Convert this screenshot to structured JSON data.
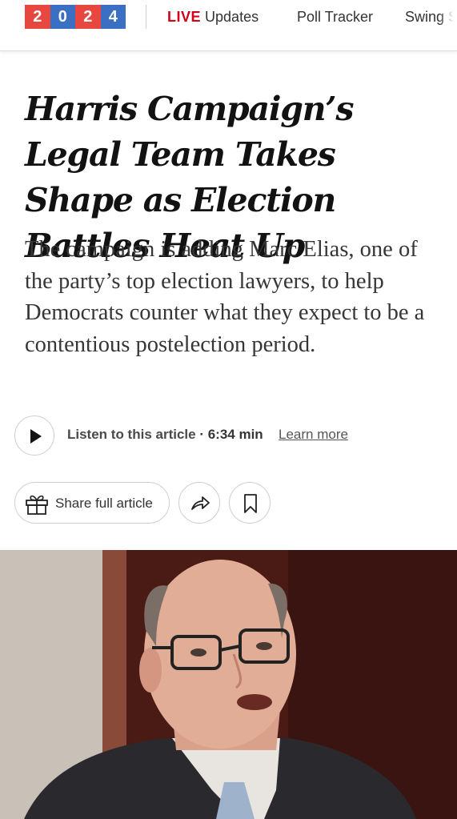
{
  "nav": {
    "logo_digits": [
      "2",
      "0",
      "2",
      "4"
    ],
    "logo_colors": [
      "#e8473f",
      "#3a6fc4",
      "#e8473f",
      "#3a6fc4"
    ],
    "live_label": "LIVE",
    "live_suffix": "Updates",
    "poll_tracker": "Poll Tracker",
    "swing": "Swing S"
  },
  "article": {
    "headline": "Harris Campaign’s Legal Team Takes Shape as Election Battles Heat Up",
    "summary": "The campaign is adding Marc Elias, one of the party’s top election lawyers, to help Democrats counter what they expect to be a contentious postelection period."
  },
  "audio": {
    "listen_label": "Listen to this article",
    "separator": " · ",
    "duration": "6:34 min",
    "learn_more": "Learn more"
  },
  "actions": {
    "share_label": "Share full article"
  },
  "icons": {
    "play": "play-icon",
    "gift": "gift-icon",
    "forward": "share-arrow-icon",
    "bookmark": "bookmark-icon"
  },
  "colors": {
    "live_red": "#d0021b",
    "text_dark": "#121212",
    "summary_gray": "#363636"
  }
}
